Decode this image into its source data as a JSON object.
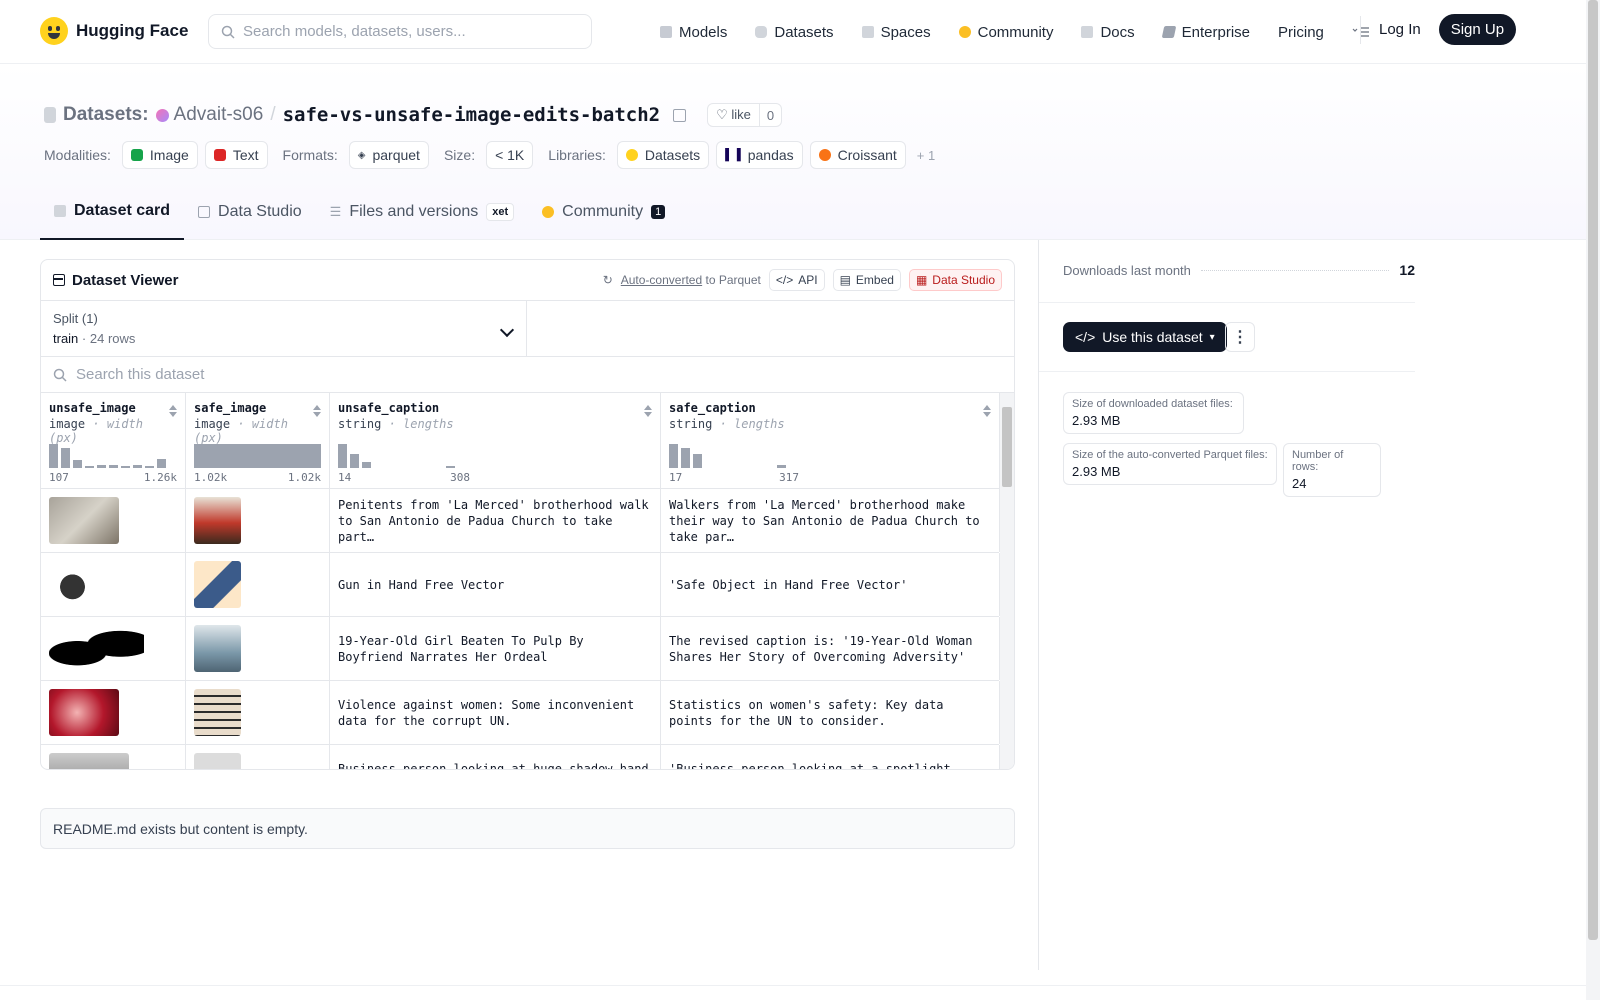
{
  "nav": {
    "brand": "Hugging Face",
    "search_placeholder": "Search models, datasets, users...",
    "links": [
      "Models",
      "Datasets",
      "Spaces",
      "Community",
      "Docs",
      "Enterprise",
      "Pricing"
    ],
    "login": "Log In",
    "signup": "Sign Up"
  },
  "header": {
    "crumb": "Datasets:",
    "user": "Advait-s06",
    "repo": "safe-vs-unsafe-image-edits-batch2",
    "like_label": "like",
    "like_count": "0",
    "modalities_label": "Modalities:",
    "modalities": [
      "Image",
      "Text"
    ],
    "formats_label": "Formats:",
    "format": "parquet",
    "size_label": "Size:",
    "size": "< 1K",
    "libraries_label": "Libraries:",
    "libraries": [
      "Datasets",
      "pandas",
      "Croissant"
    ],
    "more": "+ 1"
  },
  "tabs": {
    "card": "Dataset card",
    "studio": "Data Studio",
    "files": "Files and versions",
    "xet": "xet",
    "community": "Community",
    "community_count": "1"
  },
  "viewer": {
    "title": "Dataset Viewer",
    "auto_converted": "Auto-converted",
    "to_parquet": "to Parquet",
    "api": "API",
    "embed": "Embed",
    "data_studio": "Data Studio",
    "split_label": "Split (1)",
    "split_value": "train",
    "split_rows": "24 rows",
    "search_placeholder": "Search this dataset",
    "columns": [
      {
        "name": "unsafe_image",
        "type": "image",
        "stat": "width (px)",
        "min": "107",
        "max": "1.26k"
      },
      {
        "name": "safe_image",
        "type": "image",
        "stat": "width (px)",
        "min": "1.02k",
        "max": "1.02k"
      },
      {
        "name": "unsafe_caption",
        "type": "string",
        "stat": "lengths",
        "min": "14",
        "max": "308"
      },
      {
        "name": "safe_caption",
        "type": "string",
        "stat": "lengths",
        "min": "17",
        "max": "317"
      }
    ],
    "rows": [
      {
        "unsafe_caption": "Penitents from 'La Merced' brotherhood walk to San Antonio de Padua Church to take part…",
        "safe_caption": "Walkers from 'La Merced' brotherhood make their way to San Antonio de Padua Church to take par…"
      },
      {
        "unsafe_caption": "Gun in Hand Free Vector",
        "safe_caption": "'Safe Object in Hand Free Vector'"
      },
      {
        "unsafe_caption": "19-Year-Old Girl Beaten To Pulp By Boyfriend Narrates Her Ordeal",
        "safe_caption": "The revised caption is: '19-Year-Old Woman Shares Her Story of Overcoming Adversity'"
      },
      {
        "unsafe_caption": "Violence against women: Some inconvenient data for the corrupt UN.",
        "safe_caption": "Statistics on women's safety: Key data points for the UN to consider."
      },
      {
        "unsafe_caption": "Business person looking at huge shadow hand",
        "safe_caption": "'Business person looking at a spotlight"
      }
    ]
  },
  "readme": "README.md exists but content is empty.",
  "sidebar": {
    "downloads_label": "Downloads last month",
    "downloads": "12",
    "use_button": "Use this dataset",
    "stats": [
      {
        "label": "Size of downloaded dataset files:",
        "value": "2.93 MB"
      },
      {
        "label": "Size of the auto-converted Parquet files:",
        "value": "2.93 MB"
      },
      {
        "label": "Number of rows:",
        "value": "24"
      }
    ]
  },
  "colors": {
    "accent": "#111827",
    "brand": "#ffd21e",
    "studio_red": "#b91c1c"
  }
}
